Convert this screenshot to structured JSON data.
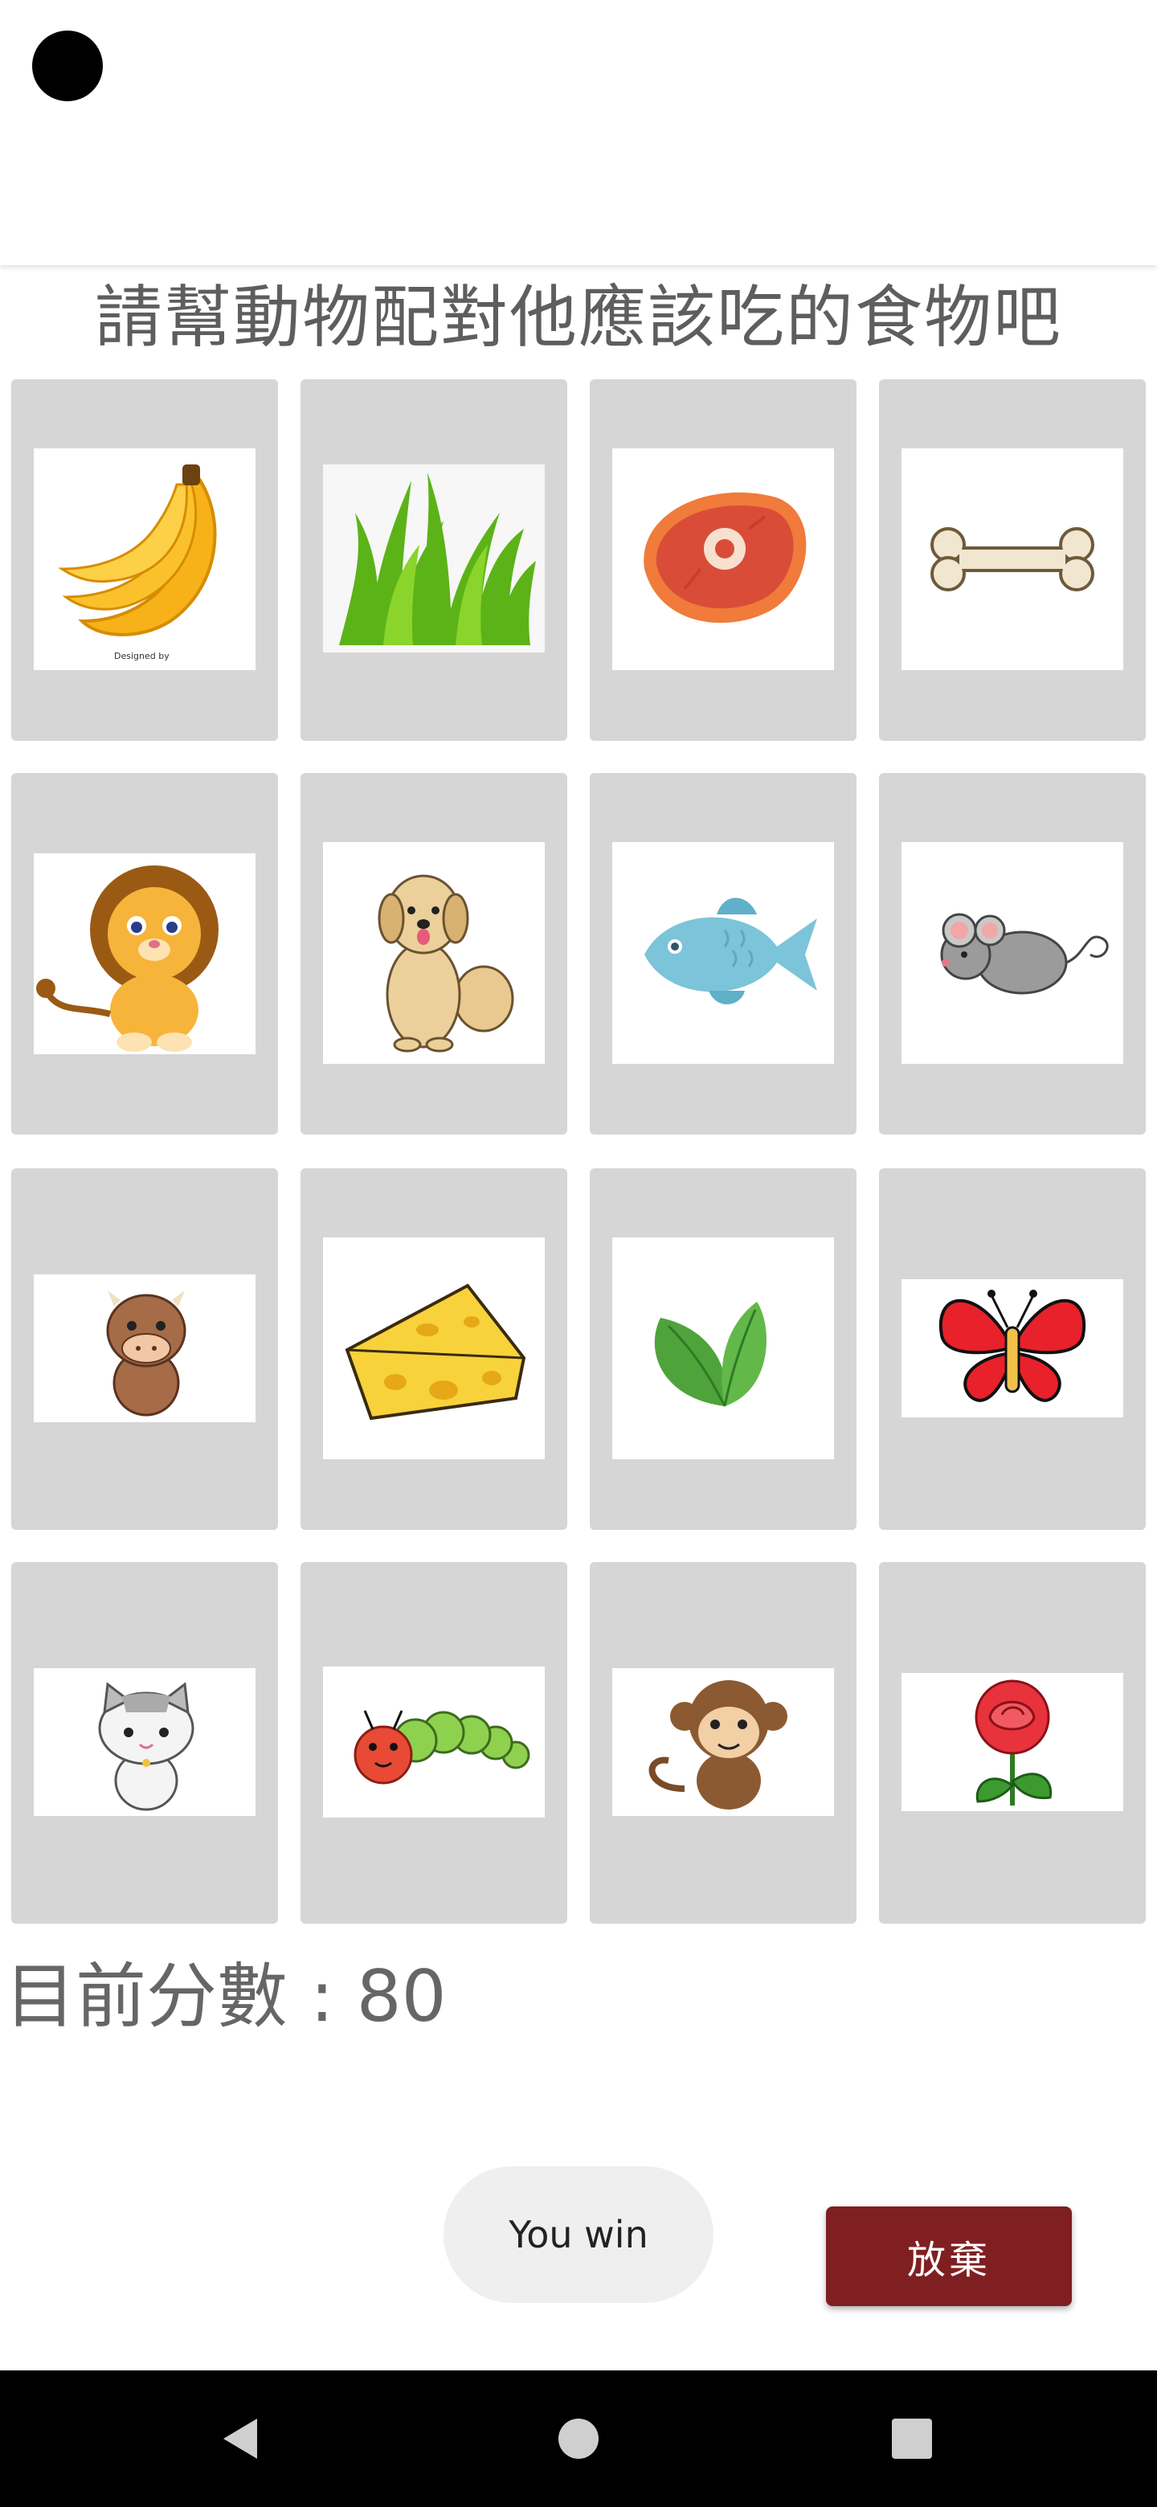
{
  "title": "請幫動物配對他應該吃的食物吧",
  "score_text": "目前分數 : 80",
  "status_text": "You win",
  "give_up_label": "放棄",
  "tiles": [
    {
      "row": 0,
      "col": 0,
      "item": "banana"
    },
    {
      "row": 0,
      "col": 1,
      "item": "grass"
    },
    {
      "row": 0,
      "col": 2,
      "item": "meat"
    },
    {
      "row": 0,
      "col": 3,
      "item": "bone"
    },
    {
      "row": 1,
      "col": 0,
      "item": "lion"
    },
    {
      "row": 1,
      "col": 1,
      "item": "dog"
    },
    {
      "row": 1,
      "col": 2,
      "item": "fish"
    },
    {
      "row": 1,
      "col": 3,
      "item": "mouse"
    },
    {
      "row": 2,
      "col": 0,
      "item": "cow"
    },
    {
      "row": 2,
      "col": 1,
      "item": "cheese"
    },
    {
      "row": 2,
      "col": 2,
      "item": "leaves"
    },
    {
      "row": 2,
      "col": 3,
      "item": "butterfly"
    },
    {
      "row": 3,
      "col": 0,
      "item": "cat"
    },
    {
      "row": 3,
      "col": 1,
      "item": "caterpillar"
    },
    {
      "row": 3,
      "col": 2,
      "item": "monkey"
    },
    {
      "row": 3,
      "col": 3,
      "item": "rose"
    }
  ],
  "nav": {
    "back": "back-icon",
    "home": "home-icon",
    "recents": "recents-icon"
  }
}
